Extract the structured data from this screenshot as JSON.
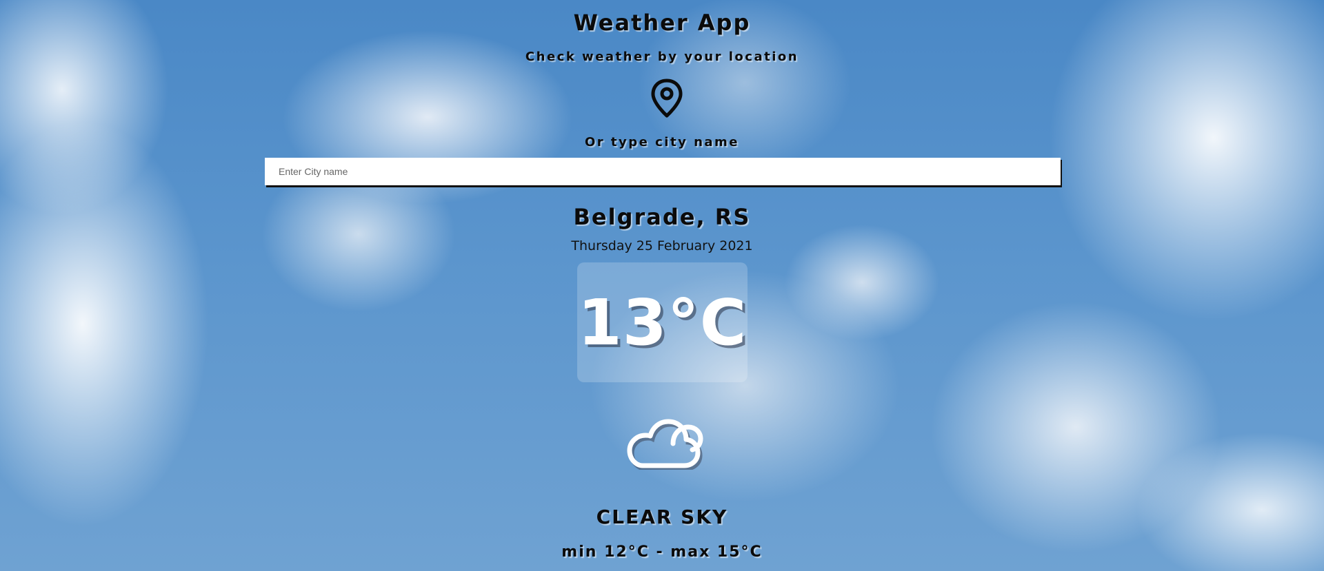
{
  "app": {
    "title": "Weather App",
    "subtitle": "Check weather by your location",
    "location_icon": "location-pin-icon",
    "or_text": "Or type city name"
  },
  "search": {
    "placeholder": "Enter City name",
    "value": ""
  },
  "weather": {
    "city": "Belgrade, RS",
    "date": "Thursday 25 February 2021",
    "temperature": "13°C",
    "icon": "cloud-icon",
    "condition": "CLEAR SKY",
    "min_max": "min 12°C - max 15°C"
  },
  "colors": {
    "sky_background": "#5b95cd",
    "text": "#0b0b0b",
    "temperature_text": "#ffffff"
  }
}
